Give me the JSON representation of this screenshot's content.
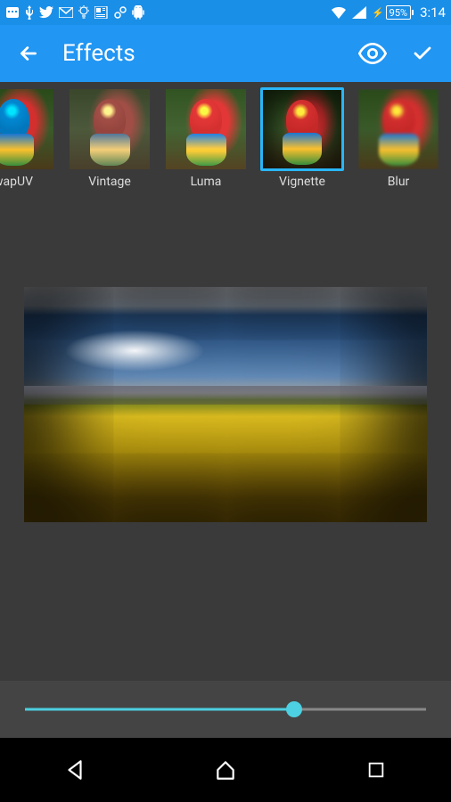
{
  "statusbar": {
    "battery": "95%",
    "time": "3:14"
  },
  "appbar": {
    "title": "Effects"
  },
  "effects": {
    "items": [
      {
        "label": "wapUV"
      },
      {
        "label": "Vintage"
      },
      {
        "label": "Luma"
      },
      {
        "label": "Vignette"
      },
      {
        "label": "Blur"
      }
    ],
    "selected_index": 3
  },
  "slider": {
    "value": 67,
    "min": 0,
    "max": 100
  },
  "colors": {
    "accent": "#2196f3",
    "slider": "#4dd0e1",
    "selection": "#29b6f6"
  }
}
